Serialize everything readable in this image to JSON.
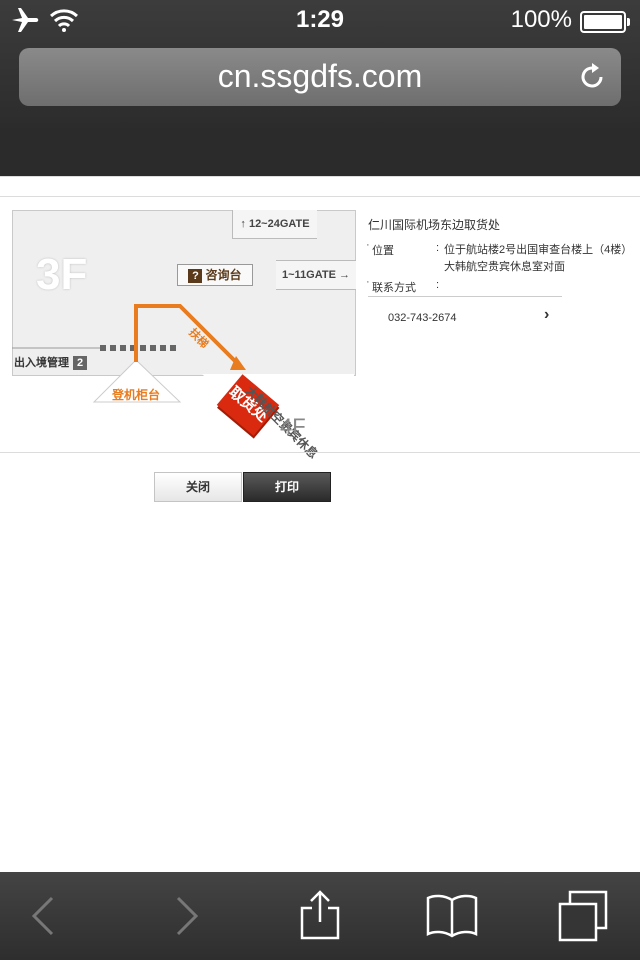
{
  "status": {
    "time": "1:29",
    "battery": "100%"
  },
  "browser": {
    "url": "cn.ssgdfs.com"
  },
  "map": {
    "floor_label": "3F",
    "gate_up": "↑ 12~24GATE",
    "gate_right": "1~11GATE →",
    "info_desk": "咨询台",
    "info_desk_icon": "?",
    "immigration": "出入境管理",
    "immigration_num": "2",
    "checkin": "登机柜台",
    "escalator": "扶梯",
    "pickup": "取货处",
    "lounge": "大韩航空贵宾休息",
    "floor4": "4F"
  },
  "info": {
    "title": "仁川国际机场东边取货处",
    "location_label": "位置",
    "location_colon": ":",
    "location_line1": "位于航站楼2号出国审查台楼上（4楼）",
    "location_line2": "大韩航空贵宾休息室对面",
    "contact_label": "联系方式",
    "contact_colon": ":",
    "phone": "032-743-2674"
  },
  "buttons": {
    "close": "关闭",
    "print": "打印"
  },
  "colors": {
    "accent_orange": "#e87c1e",
    "pickup_red": "#d9290f"
  }
}
